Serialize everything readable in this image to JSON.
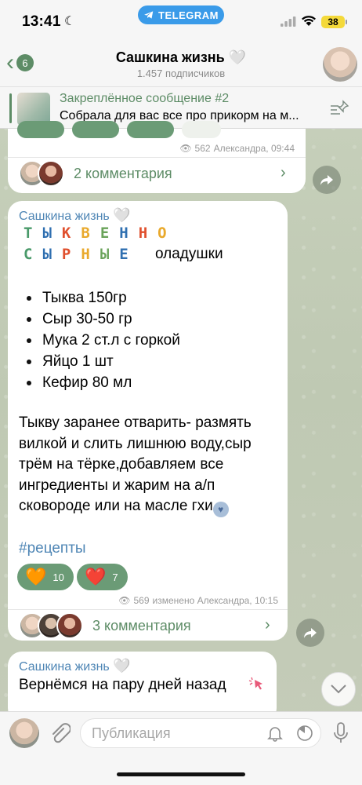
{
  "status_bar": {
    "time": "13:41",
    "app_pill": "TELEGRAM",
    "battery": "38"
  },
  "header": {
    "back_count": "6",
    "title": "Сашкина жизнь",
    "title_heart": "🤍",
    "subscribers": "1.457 подписчиков"
  },
  "pinned": {
    "title": "Закреплённое сообщение #2",
    "text": "Собрала для вас все про прикорм на м..."
  },
  "post1": {
    "views": "562",
    "meta": "Александра, 09:44",
    "comments": "2 комментария"
  },
  "post2": {
    "author": "Сашкина жизнь",
    "author_heart": "🤍",
    "title_line1": "ТЫКВЕННО",
    "title_line2": "СЫРНЫЕ",
    "title_rest": "оладушки",
    "ingredients": [
      "Тыква 150гр",
      "Сыр 30-50 гр",
      "Мука 2 ст.л с горкой",
      "Яйцо 1 шт",
      "Кефир 80 мл"
    ],
    "text": "Тыкву заранее отварить- размять вилкой и слить лишнюю воду,сыр трём на тёрке,добавляем все ингредиенты и жарим на а/п сковороде или на масле гхи",
    "hashtag": "#рецепты",
    "reactions": [
      {
        "emoji": "🧡",
        "count": "10"
      },
      {
        "emoji": "❤️",
        "count": "7"
      }
    ],
    "views": "569",
    "meta": "изменено Александра, 10:15",
    "comments": "3 комментария"
  },
  "post3": {
    "author": "Сашкина жизнь",
    "author_heart": "🤍",
    "text": "Вернёмся на пару дней назад"
  },
  "composer": {
    "placeholder": "Публикация"
  },
  "colors": {
    "accent": "#5d8c66",
    "link": "#4f86b5",
    "reaction_bg": "#6b9b76",
    "title_letters": [
      "#4a9a6a",
      "#2f6fb0",
      "#e0502e",
      "#e9a92c",
      "#6aa35a",
      "#2f6fb0",
      "#e0502e",
      "#e9a92c"
    ]
  }
}
